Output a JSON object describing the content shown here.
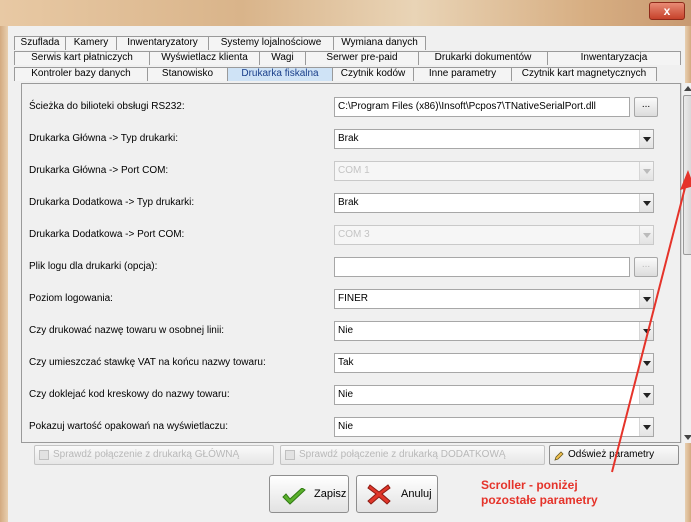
{
  "window": {
    "close_glyph": "x"
  },
  "tabs": {
    "row1": [
      "Szuflada",
      "Kamery",
      "Inwentaryzatory",
      "Systemy lojalnościowe",
      "Wymiana danych"
    ],
    "row2": [
      "Serwis kart płatniczych",
      "Wyświetlacz klienta",
      "Wagi",
      "Serwer pre-paid",
      "Drukarki dokumentów",
      "Inwentaryzacja"
    ],
    "row3": [
      "Kontroler bazy danych",
      "Stanowisko",
      "Drukarka fiskalna",
      "Czytnik kodów",
      "Inne parametry",
      "Czytnik kart magnetycznych"
    ],
    "active": "Drukarka fiskalna"
  },
  "params": [
    {
      "label": "Ścieżka do bilioteki obsługi RS232:",
      "value": "C:\\Program Files (x86)\\Insoft\\Pcpos7\\TNativeSerialPort.dll",
      "kind": "path",
      "browse_label": "..."
    },
    {
      "label": "Drukarka Główna -> Typ drukarki:",
      "value": "Brak",
      "kind": "select"
    },
    {
      "label": "Drukarka Główna -> Port COM:",
      "value": "COM 1",
      "kind": "select-disabled"
    },
    {
      "label": "Drukarka Dodatkowa -> Typ drukarki:",
      "value": "Brak",
      "kind": "select"
    },
    {
      "label": "Drukarka Dodatkowa -> Port COM:",
      "value": "COM 3",
      "kind": "select-disabled"
    },
    {
      "label": "Plik logu dla drukarki (opcja):",
      "value": "",
      "kind": "path-empty",
      "browse_label": "..."
    },
    {
      "label": "Poziom logowania:",
      "value": "FINER",
      "kind": "select"
    },
    {
      "label": "Czy drukować nazwę towaru w osobnej linii:",
      "value": "Nie",
      "kind": "select"
    },
    {
      "label": "Czy umieszczać stawkę VAT na końcu nazwy towaru:",
      "value": "Tak",
      "kind": "select"
    },
    {
      "label": "Czy doklejać kod kreskowy do nazwy towaru:",
      "value": "Nie",
      "kind": "select"
    },
    {
      "label": "Pokazuj wartość opakowań na wyświetlaczu:",
      "value": "Nie",
      "kind": "select"
    }
  ],
  "actions": {
    "check_main": "Sprawdź połączenie z drukarką GŁÓWNĄ",
    "check_extra": "Sprawdź połączenie z drukarką DODATKOWĄ",
    "refresh": "Odśwież parametry"
  },
  "footer": {
    "save": "Zapisz",
    "cancel": "Anuluj"
  },
  "annotation": {
    "line1": "Scroller - poniżej",
    "line2": "pozostałe parametry",
    "color": "#e5332a"
  }
}
